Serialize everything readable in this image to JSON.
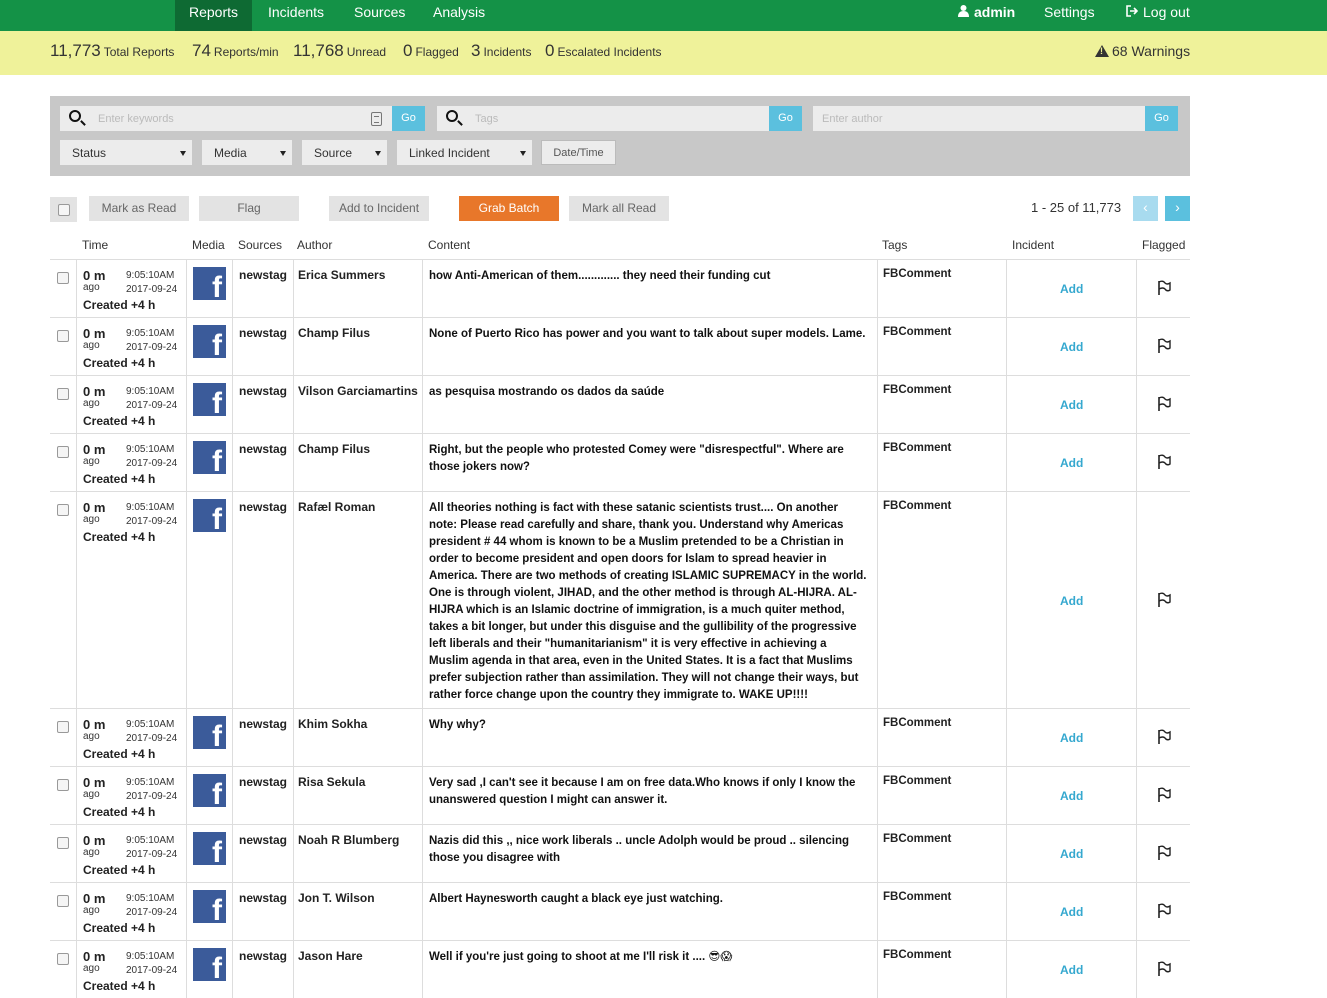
{
  "nav": {
    "tabs": [
      "Reports",
      "Incidents",
      "Sources",
      "Analysis"
    ],
    "user": "admin",
    "settings": "Settings",
    "logout": "Log out"
  },
  "stats": {
    "total_reports": {
      "value": "11,773",
      "label": "Total Reports"
    },
    "reports_per_min": {
      "value": "74",
      "label": "Reports/min"
    },
    "unread": {
      "value": "11,768",
      "label": "Unread"
    },
    "flagged": {
      "value": "0",
      "label": "Flagged"
    },
    "incidents": {
      "value": "3",
      "label": "Incidents"
    },
    "escalated": {
      "value": "0",
      "label": "Escalated Incidents"
    },
    "warnings": "68 Warnings"
  },
  "filters": {
    "keywords_placeholder": "Enter keywords",
    "tags_placeholder": "Tags",
    "author_placeholder": "Enter author",
    "go": "Go",
    "status": "Status",
    "media": "Media",
    "source": "Source",
    "linked_incident": "Linked Incident",
    "datetime": "Date/Time"
  },
  "actions": {
    "mark_read": "Mark as Read",
    "flag": "Flag",
    "add_incident": "Add to Incident",
    "grab_batch": "Grab Batch",
    "mark_all_read": "Mark all Read",
    "pager": "1 - 25 of 11,773",
    "prev": "‹",
    "next": "›"
  },
  "colors": {
    "nav": "#149247",
    "stats": "#eff29a",
    "go": "#5bc0de",
    "grab": "#e8772a",
    "link": "#35a8cf",
    "facebook": "#3b5b9a"
  },
  "table": {
    "headers": [
      "Time",
      "Media",
      "Sources",
      "Author",
      "Content",
      "Tags",
      "Incident",
      "Flagged"
    ],
    "rows": [
      {
        "ago": "0 m",
        "ago_label": "ago",
        "time": "9:05:10AM",
        "date": "2017-09-24",
        "created": "Created +4 h",
        "media_icon": "facebook-icon",
        "source": "newstag",
        "author": "Erica Summers",
        "content": "how Anti-American of them............. they need their funding cut",
        "tag": "FBComment",
        "incident": "Add"
      },
      {
        "ago": "0 m",
        "ago_label": "ago",
        "time": "9:05:10AM",
        "date": "2017-09-24",
        "created": "Created +4 h",
        "media_icon": "facebook-icon",
        "source": "newstag",
        "author": "Champ Filus",
        "content": "None of Puerto Rico has power and you want to talk about super models. Lame.",
        "tag": "FBComment",
        "incident": "Add"
      },
      {
        "ago": "0 m",
        "ago_label": "ago",
        "time": "9:05:10AM",
        "date": "2017-09-24",
        "created": "Created +4 h",
        "media_icon": "facebook-icon",
        "source": "newstag",
        "author": "Vilson Garciamartins",
        "content": "as pesquisa mostrando os dados da saúde",
        "tag": "FBComment",
        "incident": "Add"
      },
      {
        "ago": "0 m",
        "ago_label": "ago",
        "time": "9:05:10AM",
        "date": "2017-09-24",
        "created": "Created +4 h",
        "media_icon": "facebook-icon",
        "source": "newstag",
        "author": "Champ Filus",
        "content": "Right, but the people who protested Comey were \"disrespectful\". Where are those jokers now?",
        "tag": "FBComment",
        "incident": "Add"
      },
      {
        "ago": "0 m",
        "ago_label": "ago",
        "time": "9:05:10AM",
        "date": "2017-09-24",
        "created": "Created +4 h",
        "media_icon": "facebook-icon",
        "source": "newstag",
        "author": "Rafæl Roman",
        "content": "All theories nothing is fact with these satanic scientists trust.... On another note: Please read carefully and share, thank you. Understand why Americas president # 44 whom is known to be a Muslim pretended to be a Christian in order to become president and open doors for Islam to spread heavier in America. There are two methods of creating ISLAMIC SUPREMACY in the world. One is through violent, JIHAD, and the other method is through AL-HIJRA. AL-HIJRA which is an Islamic doctrine of immigration, is a much quiter method, takes a bit longer, but under this disguise and the gullibility of the progressive left liberals and their \"humanitarianism\" it is very effective in achieving a Muslim agenda in that area, even in the United States. It is a fact that Muslims prefer subjection rather than assimilation. They will not change their ways, but rather force change upon the country they immigrate to. WAKE UP!!!!",
        "tag": "FBComment",
        "incident": "Add"
      },
      {
        "ago": "0 m",
        "ago_label": "ago",
        "time": "9:05:10AM",
        "date": "2017-09-24",
        "created": "Created +4 h",
        "media_icon": "facebook-icon",
        "source": "newstag",
        "author": "Khim Sokha",
        "content": "Why why?",
        "tag": "FBComment",
        "incident": "Add"
      },
      {
        "ago": "0 m",
        "ago_label": "ago",
        "time": "9:05:10AM",
        "date": "2017-09-24",
        "created": "Created +4 h",
        "media_icon": "facebook-icon",
        "source": "newstag",
        "author": "Risa Sekula",
        "content": "Very sad ,I can't see it because I am on free data.Who knows if only I know the unanswered question I might can answer it.",
        "tag": "FBComment",
        "incident": "Add"
      },
      {
        "ago": "0 m",
        "ago_label": "ago",
        "time": "9:05:10AM",
        "date": "2017-09-24",
        "created": "Created +4 h",
        "media_icon": "facebook-icon",
        "source": "newstag",
        "author": "Noah R Blumberg",
        "content": "Nazis did this ,, nice work liberals .. uncle Adolph would be proud .. silencing those you disagree with",
        "tag": "FBComment",
        "incident": "Add"
      },
      {
        "ago": "0 m",
        "ago_label": "ago",
        "time": "9:05:10AM",
        "date": "2017-09-24",
        "created": "Created +4 h",
        "media_icon": "facebook-icon",
        "source": "newstag",
        "author": "Jon T. Wilson",
        "content": "Albert Haynesworth caught a black eye just watching.",
        "tag": "FBComment",
        "incident": "Add"
      },
      {
        "ago": "0 m",
        "ago_label": "ago",
        "time": "9:05:10AM",
        "date": "2017-09-24",
        "created": "Created +4 h",
        "media_icon": "facebook-icon",
        "source": "newstag",
        "author": "Jason Hare",
        "content": "Well if you're just going to shoot at me I'll risk it .... 😎😱",
        "tag": "FBComment",
        "incident": "Add"
      }
    ]
  }
}
